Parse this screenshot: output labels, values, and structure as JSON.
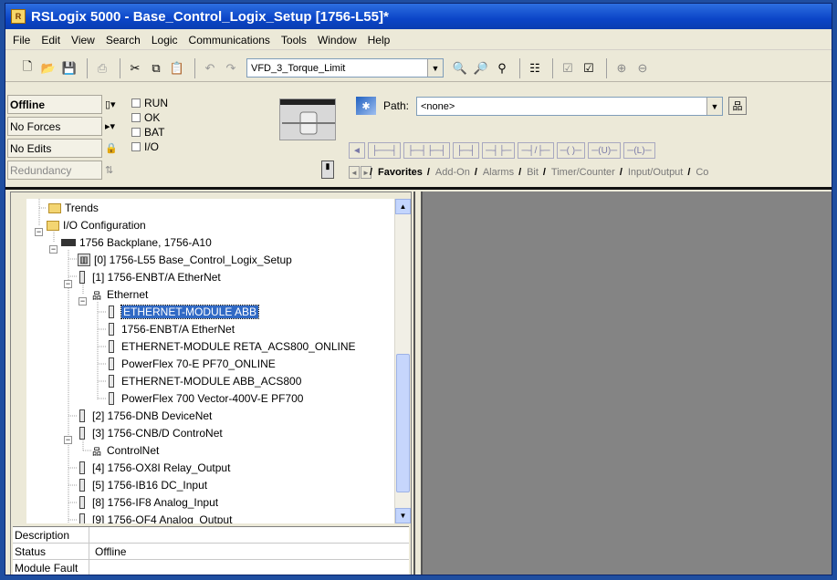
{
  "window": {
    "title": "RSLogix 5000 - Base_Control_Logix_Setup [1756-L55]*",
    "app_icon": "rslogix-icon"
  },
  "menu": [
    "File",
    "Edit",
    "View",
    "Search",
    "Logic",
    "Communications",
    "Tools",
    "Window",
    "Help"
  ],
  "toolbar": {
    "buttons_left": [
      "new-icon",
      "open-icon",
      "save-icon",
      "print-icon",
      "cut-icon",
      "copy-icon",
      "paste-icon",
      "undo-icon",
      "redo-icon"
    ],
    "tag_combo_value": "VFD_3_Torque_Limit",
    "buttons_right": [
      "find-icon",
      "find-next-icon",
      "replace-icon",
      "verify-icon",
      "verify-routine-icon",
      "verify-controller-icon",
      "zoom-in-icon",
      "zoom-out-icon"
    ]
  },
  "status": {
    "mode": "Offline",
    "forces": "No Forces",
    "edits": "No Edits",
    "redundancy": "Redundancy",
    "indicators": [
      "RUN",
      "OK",
      "BAT",
      "I/O"
    ]
  },
  "path": {
    "label": "Path:",
    "value": "<none>"
  },
  "ladder_buttons": [
    "◄",
    "├──┤",
    "├─┤├─┤",
    "├─┤",
    "─┤├─",
    "─┤/├─",
    "─( )─",
    "─(U)─",
    "─(L)─"
  ],
  "instruction_tabs": [
    "Favorites",
    "Add-On",
    "Alarms",
    "Bit",
    "Timer/Counter",
    "Input/Output",
    "Co"
  ],
  "tree": [
    {
      "label": "Trends",
      "icon": "folder-icon",
      "depth": 1
    },
    {
      "label": "I/O Configuration",
      "icon": "folder-open-icon",
      "depth": 0
    },
    {
      "label": "1756 Backplane, 1756-A10",
      "icon": "backplane-icon",
      "depth": 1
    },
    {
      "label": "[0] 1756-L55 Base_Control_Logix_Setup",
      "icon": "controller-icon",
      "depth": 2
    },
    {
      "label": "[1] 1756-ENBT/A EtherNet",
      "icon": "module-icon",
      "depth": 2
    },
    {
      "label": "Ethernet",
      "icon": "network-icon",
      "depth": 3
    },
    {
      "label": "ETHERNET-MODULE ABB",
      "icon": "module-icon",
      "depth": 4,
      "selected": true
    },
    {
      "label": "1756-ENBT/A EtherNet",
      "icon": "module-icon",
      "depth": 4
    },
    {
      "label": "ETHERNET-MODULE RETA_ACS800_ONLINE",
      "icon": "module-icon",
      "depth": 4
    },
    {
      "label": "PowerFlex 70-E PF70_ONLINE",
      "icon": "module-icon",
      "depth": 4
    },
    {
      "label": "ETHERNET-MODULE ABB_ACS800",
      "icon": "module-icon",
      "depth": 4
    },
    {
      "label": "PowerFlex 700 Vector-400V-E PF700",
      "icon": "module-icon",
      "depth": 4
    },
    {
      "label": "[2] 1756-DNB DeviceNet",
      "icon": "module-icon",
      "depth": 2
    },
    {
      "label": "[3] 1756-CNB/D ControNet",
      "icon": "module-icon",
      "depth": 2
    },
    {
      "label": "ControlNet",
      "icon": "network-icon",
      "depth": 3
    },
    {
      "label": "[4] 1756-OX8I Relay_Output",
      "icon": "module-icon",
      "depth": 2
    },
    {
      "label": "[5] 1756-IB16 DC_Input",
      "icon": "module-icon",
      "depth": 2
    },
    {
      "label": "[8] 1756-IF8 Analog_Input",
      "icon": "module-icon",
      "depth": 2
    },
    {
      "label": "[9] 1756-OF4 Analog_Output",
      "icon": "module-icon",
      "depth": 2
    }
  ],
  "properties": [
    {
      "key": "Description",
      "value": ""
    },
    {
      "key": "Status",
      "value": "Offline"
    },
    {
      "key": "Module Fault",
      "value": ""
    }
  ]
}
